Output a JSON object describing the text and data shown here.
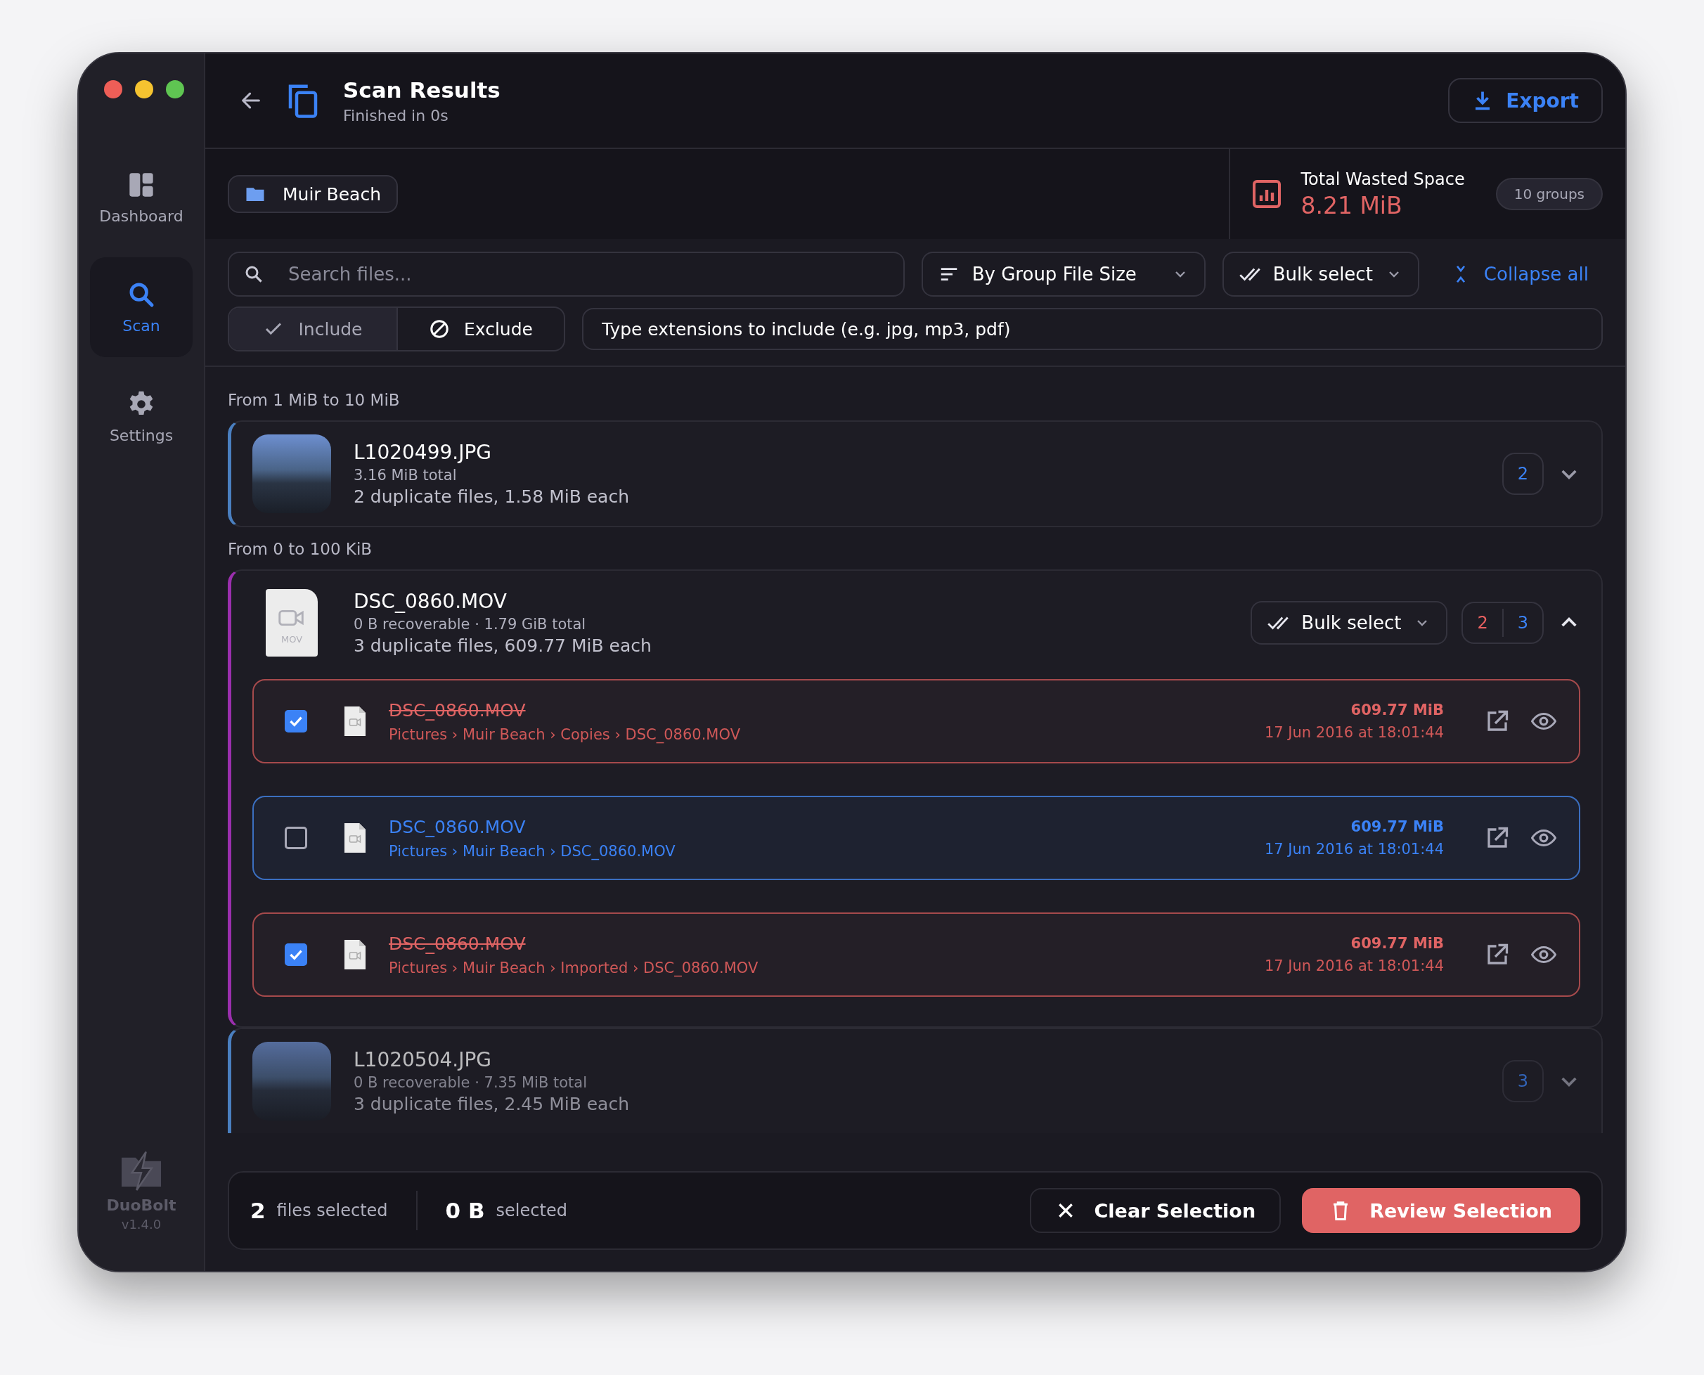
{
  "sidebar": {
    "items": [
      {
        "kind": "dashboard",
        "label": "Dashboard",
        "selected": false
      },
      {
        "kind": "scan",
        "label": "Scan",
        "selected": true
      },
      {
        "kind": "settings",
        "label": "Settings",
        "selected": false
      }
    ],
    "app_name": "DuoBolt",
    "version": "v1.4.0"
  },
  "header": {
    "title": "Scan Results",
    "subtitle": "Finished in 0s",
    "export_button": "Export"
  },
  "summary": {
    "folder": "Muir Beach",
    "stat_label": "Total Wasted Space",
    "stat_value": "8.21 MiB",
    "groups_badge": "10 groups"
  },
  "toolbar": {
    "search": {
      "placeholder": "Search files..."
    },
    "sort": "By Group File Size",
    "bulk_select": "Bulk select",
    "collapse": "Collapse all",
    "filter_modes": [
      {
        "kind": "include",
        "label": "Include",
        "selected": true
      },
      {
        "kind": "exclude",
        "label": "Exclude",
        "selected": false
      }
    ],
    "extensions": {
      "placeholder": "Type extensions to include (e.g. jpg, mp3, pdf)"
    }
  },
  "sections": [
    {
      "heading": "From 1 MiB to 10 MiB",
      "groups": [
        {
          "name": "L1020499.JPG",
          "kind": "photo",
          "meta": "3.16 MiB total",
          "summary": "2 duplicate files, 1.58 MiB each",
          "color": "#4a7fc0",
          "expanded": false,
          "faded": false,
          "counts": [
            {
              "kind": "total",
              "value": "2"
            }
          ]
        }
      ]
    },
    {
      "heading": "From 0 to 100 KiB",
      "groups": [
        {
          "name": "DSC_0860.MOV",
          "kind": "file",
          "thumb_label": "MOV",
          "meta": "0 B recoverable · 1.79 GiB total",
          "summary": "3 duplicate files, 609.77 MiB each",
          "color": "#9b2fae",
          "expanded": true,
          "faded": false,
          "bulk_select": "Bulk select",
          "counts": [
            {
              "kind": "marked",
              "value": "2"
            },
            {
              "kind": "total",
              "value": "3"
            }
          ],
          "files": [
            {
              "checked": true,
              "name": "DSC_0860.MOV",
              "path": "Pictures › Muir Beach › Copies › DSC_0860.MOV",
              "size": "609.77 MiB",
              "date": "17 Jun 2016 at 18:01:44"
            },
            {
              "checked": false,
              "name": "DSC_0860.MOV",
              "path": "Pictures › Muir Beach › DSC_0860.MOV",
              "size": "609.77 MiB",
              "date": "17 Jun 2016 at 18:01:44"
            },
            {
              "checked": true,
              "name": "DSC_0860.MOV",
              "path": "Pictures › Muir Beach › Imported › DSC_0860.MOV",
              "size": "609.77 MiB",
              "date": "17 Jun 2016 at 18:01:44"
            }
          ]
        },
        {
          "name": "L1020504.JPG",
          "kind": "photo",
          "meta": "0 B recoverable · 7.35 MiB total",
          "summary": "3 duplicate files, 2.45 MiB each",
          "color": "#4a7fc0",
          "expanded": false,
          "faded": true,
          "counts": [
            {
              "kind": "total",
              "value": "3"
            }
          ]
        }
      ]
    }
  ],
  "footer": {
    "selected_count": "2",
    "count_label": "files selected",
    "selected_size": "0 B",
    "size_label": "selected",
    "clear_button": "Clear Selection",
    "review_button": "Review Selection"
  }
}
